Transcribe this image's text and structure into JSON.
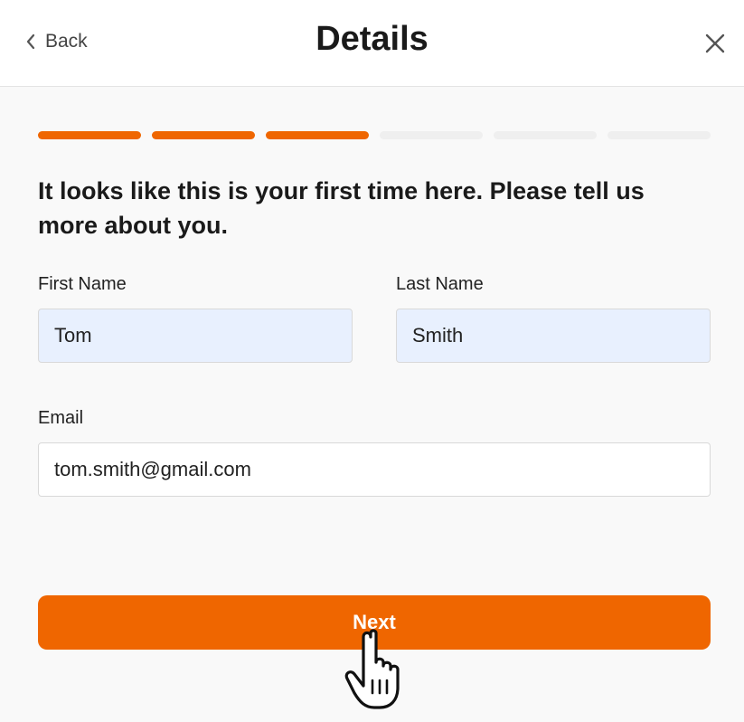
{
  "header": {
    "back_label": "Back",
    "title": "Details"
  },
  "progress": {
    "total_steps": 6,
    "completed_steps": 3,
    "accent_color": "#ef6600",
    "inactive_color": "#efefef"
  },
  "intro": {
    "text": "It looks like this is your first time here. Please tell us more about you."
  },
  "form": {
    "first_name": {
      "label": "First Name",
      "value": "Tom"
    },
    "last_name": {
      "label": "Last Name",
      "value": "Smith"
    },
    "email": {
      "label": "Email",
      "value": "tom.smith@gmail.com"
    }
  },
  "actions": {
    "next_label": "Next"
  },
  "icons": {
    "back": "chevron-left-icon",
    "close": "close-icon",
    "cursor": "hand-pointer-cursor"
  }
}
